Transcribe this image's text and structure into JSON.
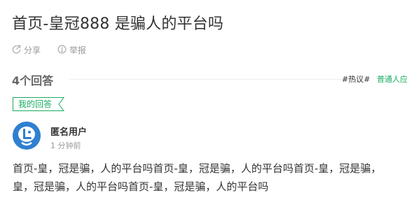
{
  "question": {
    "title": "首页-皇冠888 是骗人的平台吗"
  },
  "actions": {
    "share_label": "分享",
    "report_label": "举报",
    "share_icon": "share-icon",
    "report_icon": "report-icon"
  },
  "answers": {
    "count_label": "4个回答",
    "hot_tag": "#热议#",
    "hot_link": "普通人应"
  },
  "my_answer_badge": "我的回答",
  "answer": {
    "user_name": "匿名用户",
    "time": "1 分钟前",
    "text_line1": "首页-皇，冠是骗，人的平台吗首页-皇，冠是骗，人的平台吗首页-皇，冠是骗，",
    "text_line2": "皇，冠是骗，人的平台吗首页-皇，冠是骗，人的平台吗"
  },
  "colors": {
    "accent_green": "#1aad60",
    "avatar_blue": "#2f80d0"
  }
}
